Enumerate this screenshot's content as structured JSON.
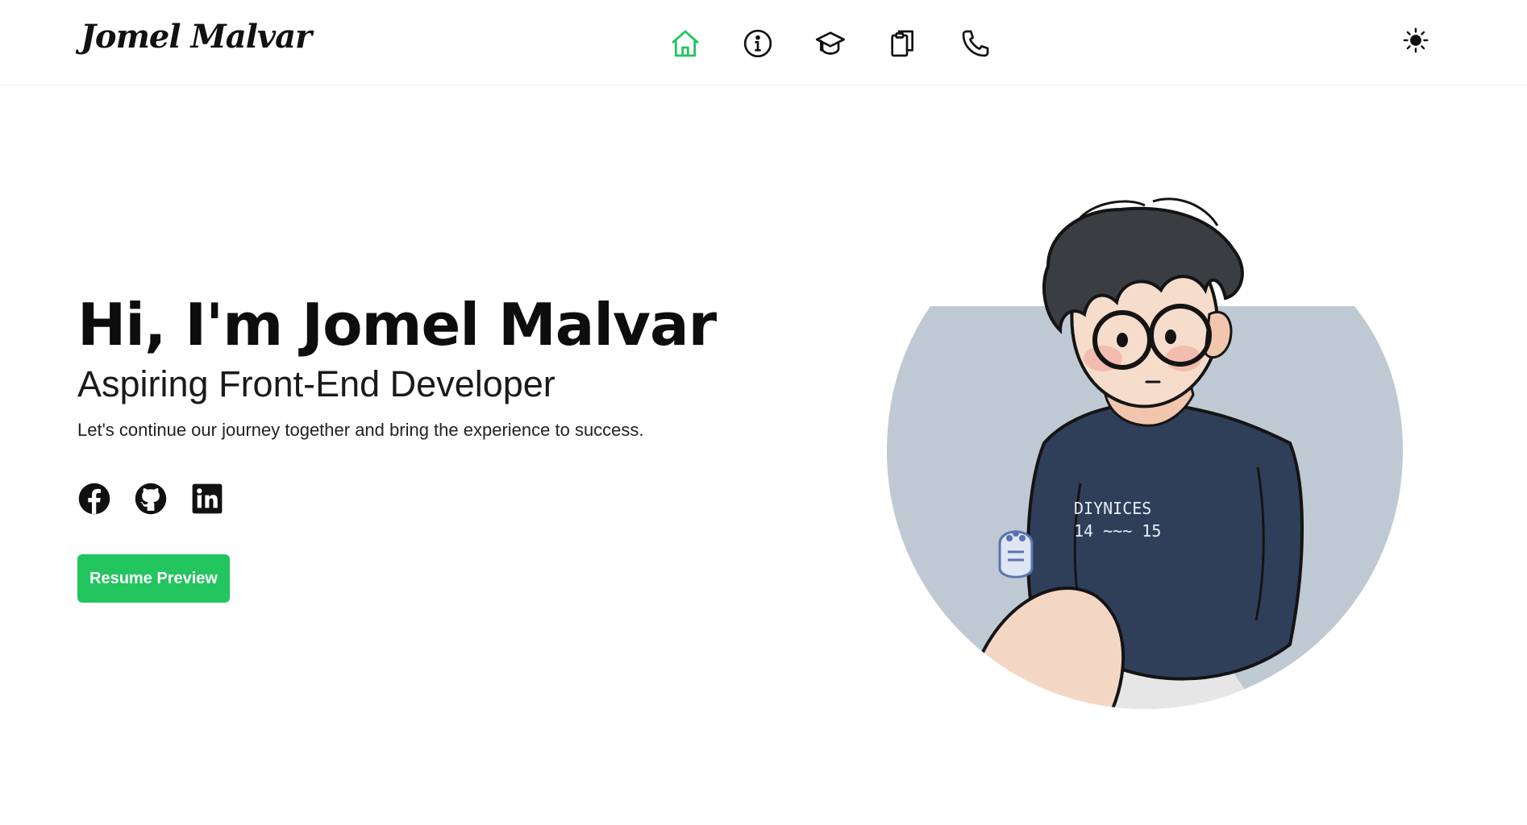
{
  "header": {
    "logo_text": "Jomel Malvar",
    "nav": [
      {
        "icon": "home-icon",
        "active": true
      },
      {
        "icon": "info-icon",
        "active": false
      },
      {
        "icon": "graduation-cap-icon",
        "active": false
      },
      {
        "icon": "clipboard-icon",
        "active": false
      },
      {
        "icon": "phone-icon",
        "active": false
      }
    ],
    "theme_icon": "sun-icon"
  },
  "hero": {
    "title": "Hi, I'm Jomel Malvar",
    "subtitle": "Aspiring Front-End Developer",
    "tagline": "Let's continue our journey together and bring the experience to success.",
    "socials": [
      {
        "icon": "facebook-icon"
      },
      {
        "icon": "github-icon"
      },
      {
        "icon": "linkedin-icon"
      }
    ],
    "resume_button": "Resume Preview"
  },
  "portrait": {
    "image": "avatar-illustration",
    "shirt_text_line1": "DIYNICES",
    "shirt_text_line2": "14 ~~~ 15"
  },
  "colors": {
    "accent": "#22c55e",
    "text": "#111111",
    "portrait_bg": "#bfc9d3",
    "shirt": "#2f3f5a"
  }
}
